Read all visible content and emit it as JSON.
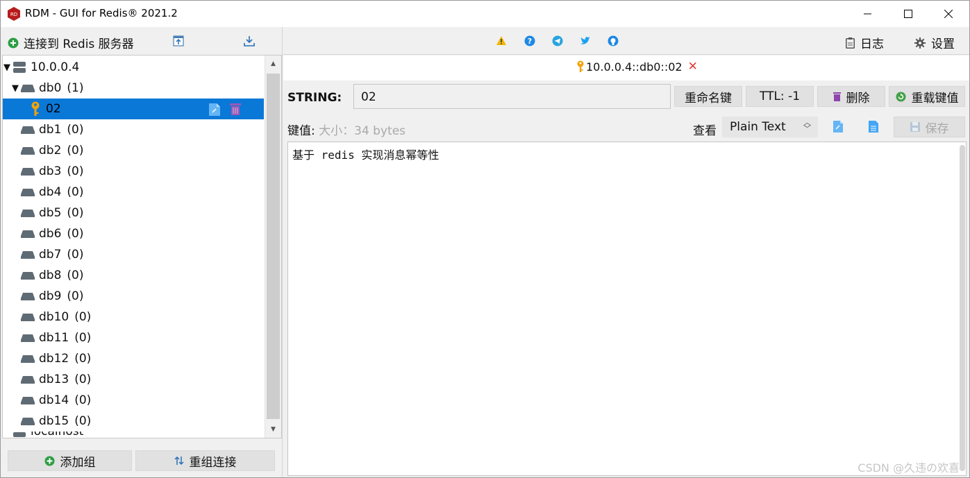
{
  "window": {
    "title": "RDM - GUI for Redis® 2021.2",
    "controls": [
      "minimize",
      "maximize",
      "close"
    ]
  },
  "left_toolbar": {
    "connect_label": "连接到 Redis 服务器",
    "icons": [
      "import-icon",
      "export-icon"
    ]
  },
  "tree": {
    "connection": "10.0.0.4",
    "databases": [
      {
        "name": "db0",
        "count": "(1)",
        "expanded": true,
        "keys": [
          "02"
        ]
      },
      {
        "name": "db1",
        "count": "(0)"
      },
      {
        "name": "db2",
        "count": "(0)"
      },
      {
        "name": "db3",
        "count": "(0)"
      },
      {
        "name": "db4",
        "count": "(0)"
      },
      {
        "name": "db5",
        "count": "(0)"
      },
      {
        "name": "db6",
        "count": "(0)"
      },
      {
        "name": "db7",
        "count": "(0)"
      },
      {
        "name": "db8",
        "count": "(0)"
      },
      {
        "name": "db9",
        "count": "(0)"
      },
      {
        "name": "db10",
        "count": "(0)"
      },
      {
        "name": "db11",
        "count": "(0)"
      },
      {
        "name": "db12",
        "count": "(0)"
      },
      {
        "name": "db13",
        "count": "(0)"
      },
      {
        "name": "db14",
        "count": "(0)"
      },
      {
        "name": "db15",
        "count": "(0)"
      }
    ],
    "partial_next": "localhost"
  },
  "left_bottom": {
    "add_group": "添加组",
    "regroup": "重组连接"
  },
  "right_toolbar": {
    "icons": [
      "warning-icon",
      "help-icon",
      "telegram-icon",
      "twitter-icon",
      "github-icon"
    ],
    "log_label": "日志",
    "settings_label": "设置"
  },
  "tab": {
    "label": "10.0.0.4::db0::02"
  },
  "key_view": {
    "type": "STRING:",
    "key_name": "02",
    "rename_label": "重命名键",
    "ttl_label": "TTL:  -1",
    "delete_label": "删除",
    "reload_label": "重载键值",
    "value_label": "键值:",
    "size_label": "大小：34 bytes",
    "view_label": "查看",
    "format": "Plain Text",
    "save_label": "保存",
    "value": "基于 redis 实现消息幂等性"
  },
  "watermark": "CSDN @久违の欢喜",
  "colors": {
    "selection": "#0a78d7",
    "accent_green": "#2e9e44",
    "delete_purple": "#8e44ad",
    "close_red": "#e53935",
    "key_gold": "#f0a30a"
  }
}
